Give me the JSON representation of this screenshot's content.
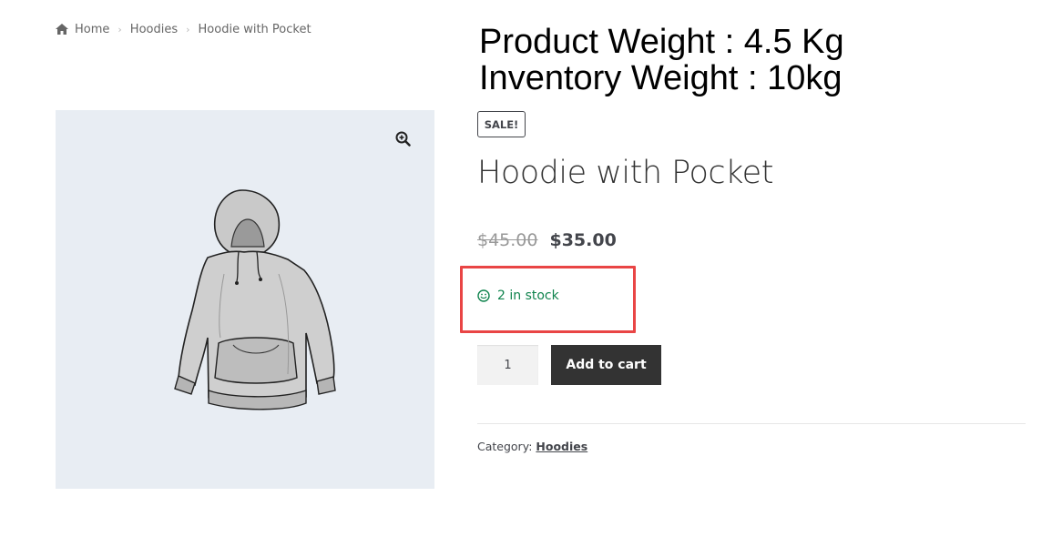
{
  "breadcrumb": {
    "home": "Home",
    "category": "Hoodies",
    "current": "Hoodie with Pocket"
  },
  "note": {
    "line1": "Product Weight : 4.5 Kg",
    "line2": "Inventory Weight : 10kg"
  },
  "product": {
    "sale_badge": "SALE!",
    "title": "Hoodie with Pocket",
    "old_price": "$45.00",
    "new_price": "$35.00",
    "stock_text": "2 in stock",
    "quantity": "1",
    "add_to_cart_label": "Add to cart",
    "category_label": "Category:",
    "category_value": "Hoodies"
  },
  "icons": {
    "home": "home-icon",
    "zoom": "zoom-in-icon",
    "stock": "smile-icon"
  },
  "colors": {
    "stock_green": "#0f834d",
    "button_dark": "#333333",
    "highlight_red": "#e94545",
    "gallery_bg": "#e8edf3"
  }
}
